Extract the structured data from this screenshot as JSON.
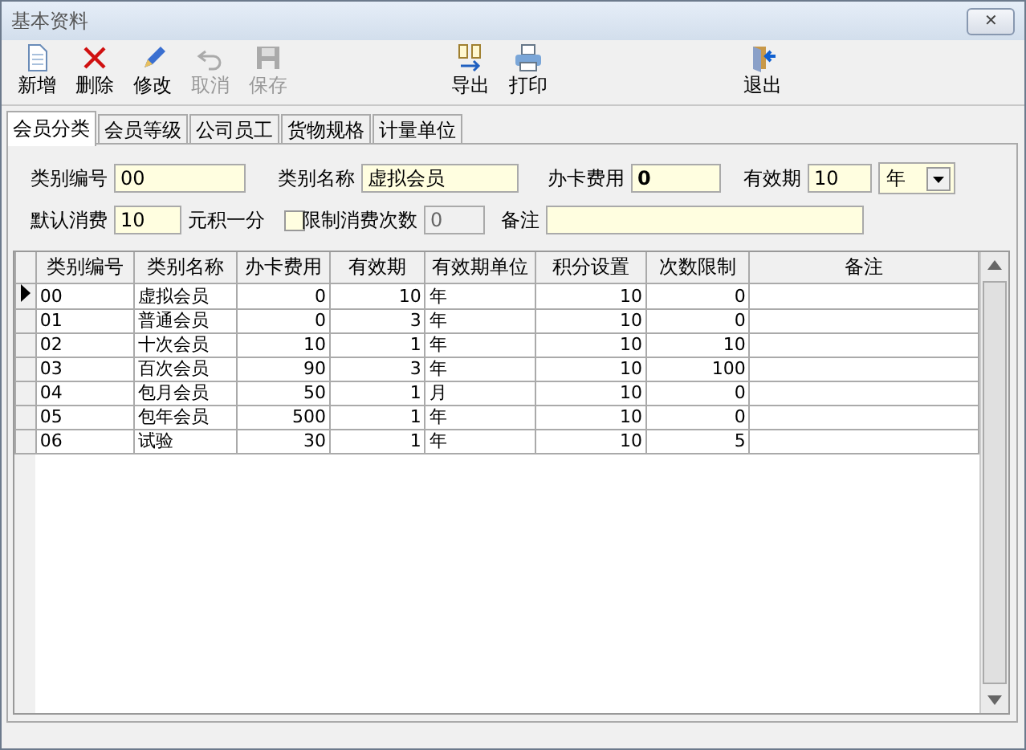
{
  "window": {
    "title": "基本资料",
    "close": "✕"
  },
  "toolbar": [
    {
      "label": "新增",
      "disabled": false
    },
    {
      "label": "删除",
      "disabled": false
    },
    {
      "label": "修改",
      "disabled": false
    },
    {
      "label": "取消",
      "disabled": true
    },
    {
      "label": "保存",
      "disabled": true
    },
    {
      "label": "导出",
      "disabled": false
    },
    {
      "label": "打印",
      "disabled": false
    },
    {
      "label": "退出",
      "disabled": false
    }
  ],
  "tabs": [
    {
      "label": "会员分类",
      "selected": true
    },
    {
      "label": "会员等级",
      "selected": false
    },
    {
      "label": "公司员工",
      "selected": false
    },
    {
      "label": "货物规格",
      "selected": false
    },
    {
      "label": "计量单位",
      "selected": false
    }
  ],
  "form": {
    "code_label": "类别编号",
    "code": "00",
    "name_label": "类别名称",
    "name": "虚拟会员",
    "fee_label": "办卡费用",
    "fee": "0",
    "period_label": "有效期",
    "period": "10",
    "unit": "年",
    "default_label": "默认消费",
    "default": "10",
    "points_label": "元积一分",
    "limit_label": "限制消费次数",
    "limit_checked": false,
    "limit": "0",
    "note_label": "备注"
  },
  "table": {
    "columns": [
      "类别编号",
      "类别名称",
      "办卡费用",
      "有效期",
      "有效期单位",
      "积分设置",
      "次数限制",
      "备注"
    ],
    "rows": [
      {
        "selected": true,
        "cells": [
          "00",
          "虚拟会员",
          "0",
          "10",
          "年",
          "10",
          "0"
        ]
      },
      {
        "selected": false,
        "cells": [
          "01",
          "普通会员",
          "0",
          "3",
          "年",
          "10",
          "0"
        ]
      },
      {
        "selected": false,
        "cells": [
          "02",
          "十次会员",
          "10",
          "1",
          "年",
          "10",
          "10"
        ]
      },
      {
        "selected": false,
        "cells": [
          "03",
          "百次会员",
          "90",
          "3",
          "年",
          "10",
          "100"
        ]
      },
      {
        "selected": false,
        "cells": [
          "04",
          "包月会员",
          "50",
          "1",
          "月",
          "10",
          "0"
        ]
      },
      {
        "selected": false,
        "cells": [
          "05",
          "包年会员",
          "500",
          "1",
          "年",
          "10",
          "0"
        ]
      },
      {
        "selected": false,
        "cells": [
          "06",
          "试验",
          "30",
          "1",
          "年",
          "10",
          "5"
        ]
      }
    ]
  }
}
